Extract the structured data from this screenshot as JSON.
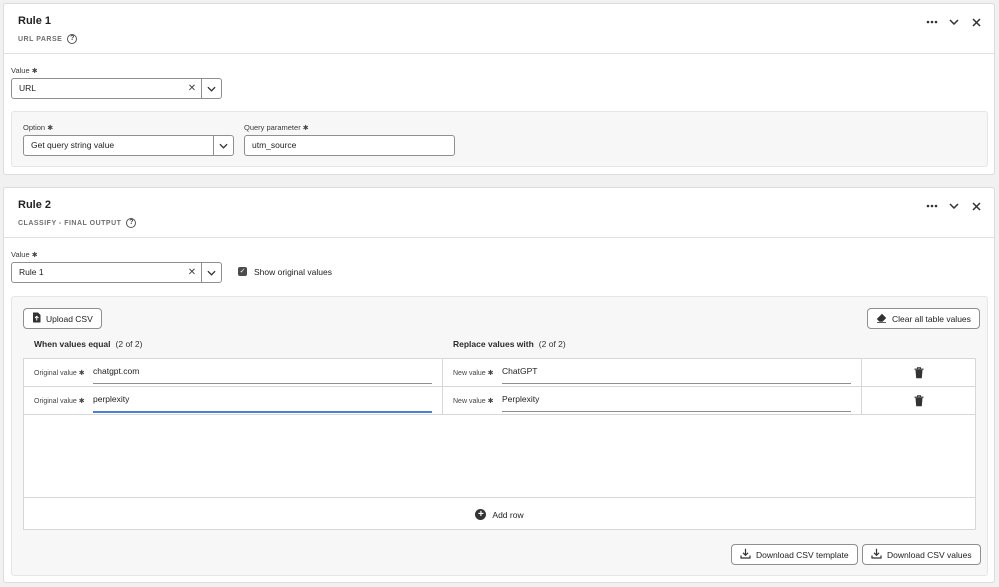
{
  "rule1": {
    "title": "Rule 1",
    "subtitle": "URL PARSE",
    "value_label": "Value",
    "value_selected": "URL",
    "option_label": "Option",
    "option_selected": "Get query string value",
    "query_label": "Query parameter",
    "query_value": "utm_source"
  },
  "rule2": {
    "title": "Rule 2",
    "subtitle": "CLASSIFY - FINAL OUTPUT",
    "value_label": "Value",
    "value_selected": "Rule 1",
    "show_original_label": "Show original values",
    "show_original_checked": true,
    "upload_label": "Upload CSV",
    "clear_label": "Clear all table values",
    "when_label": "When values equal",
    "when_count": "(2 of 2)",
    "replace_label": "Replace values with",
    "replace_count": "(2 of 2)",
    "original_label": "Original value",
    "new_label": "New value",
    "rows": [
      {
        "original": "chatgpt.com",
        "replacement": "ChatGPT"
      },
      {
        "original": "perplexity",
        "replacement": "Perplexity"
      }
    ],
    "add_row_label": "Add row",
    "download_template_label": "Download CSV template",
    "download_values_label": "Download CSV values"
  },
  "icons": {
    "more": "more-icon",
    "chevron": "chevron-down-icon",
    "close": "close-icon",
    "help": "help-icon",
    "clear": "clear-x-icon",
    "upload": "file-upload-icon",
    "eraser": "eraser-icon",
    "trash": "trash-icon",
    "add": "add-circle-icon",
    "download": "download-icon",
    "checkbox": "checkbox-checked-icon"
  }
}
